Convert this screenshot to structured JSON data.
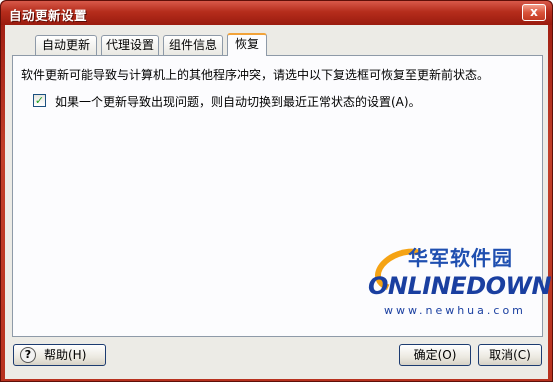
{
  "window": {
    "title": "自动更新设置",
    "close_glyph": "x"
  },
  "tabs": [
    {
      "label": "自动更新",
      "active": false
    },
    {
      "label": "代理设置",
      "active": false
    },
    {
      "label": "组件信息",
      "active": false
    },
    {
      "label": "恢复",
      "active": true
    }
  ],
  "panel": {
    "description": "软件更新可能导致与计算机上的其他程序冲突，请选中以下复选框可恢复至更新前状态。",
    "checkbox": {
      "label": "如果一个更新导致出现问题，则自动切换到最近正常状态的设置(A)。",
      "checked": true
    }
  },
  "watermark": {
    "cn_text": "华军软件园",
    "brand": "ONLINEDOWN",
    "url": "www.newhua.com"
  },
  "buttons": {
    "help": "帮助(H)",
    "ok": "确定(O)",
    "cancel": "取消(C)"
  },
  "colors": {
    "title_bar": "#b52d1c",
    "tab_accent": "#f2a33a",
    "watermark_blue": "#1a3fa0",
    "watermark_orange": "#f5a314"
  }
}
